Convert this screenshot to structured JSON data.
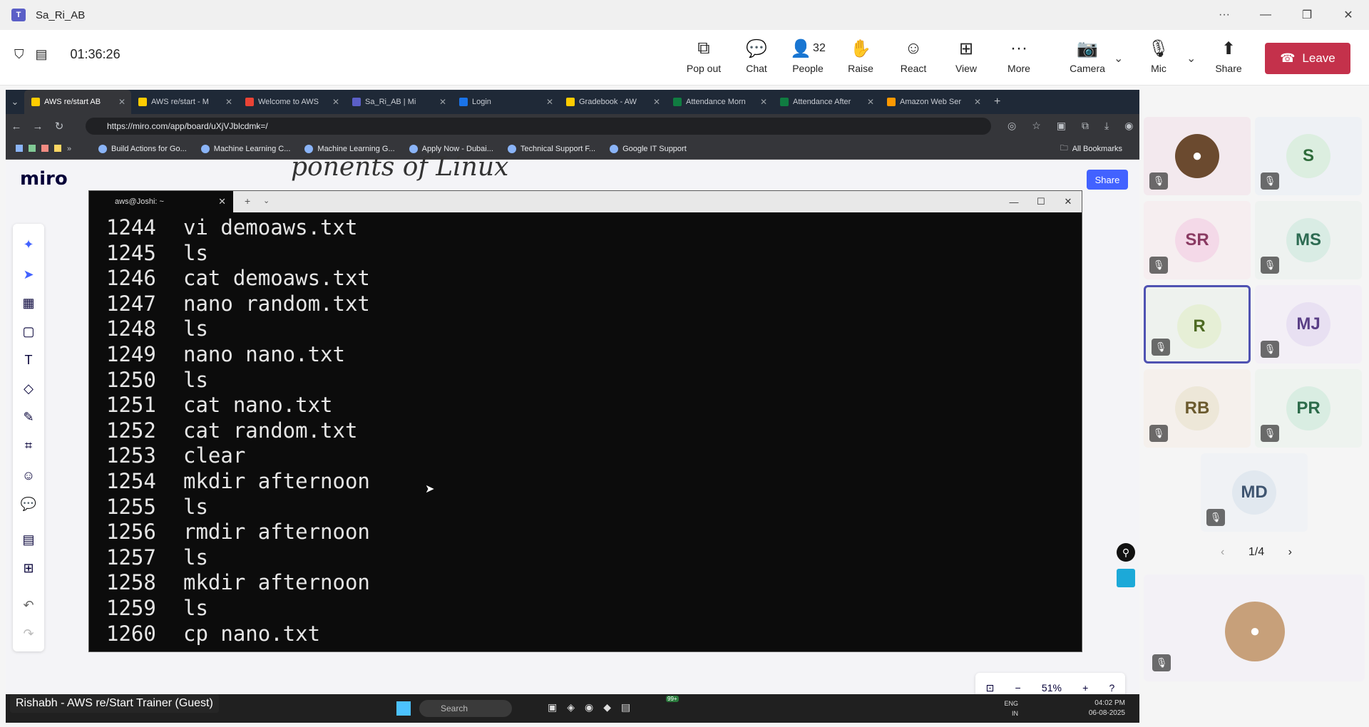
{
  "app": {
    "title": "Sa_Ri_AB",
    "logo": "T"
  },
  "meeting": {
    "timer": "01:36:26",
    "tools": [
      {
        "icon": "pop-out-icon",
        "glyph": "⧉",
        "label": "Pop out"
      },
      {
        "icon": "chat-icon",
        "glyph": "💬",
        "label": "Chat"
      },
      {
        "icon": "people-icon",
        "glyph": "👤",
        "label": "People",
        "count": "32"
      },
      {
        "icon": "raise-hand-icon",
        "glyph": "✋",
        "label": "Raise"
      },
      {
        "icon": "react-icon",
        "glyph": "☺",
        "label": "React"
      },
      {
        "icon": "view-icon",
        "glyph": "⊞",
        "label": "View"
      },
      {
        "icon": "more-icon",
        "glyph": "···",
        "label": "More"
      },
      {
        "icon": "camera-off-icon",
        "glyph": "📷",
        "label": "Camera"
      },
      {
        "icon": "mic-off-icon",
        "glyph": "🎙",
        "label": "Mic"
      },
      {
        "icon": "share-icon",
        "glyph": "⬆",
        "label": "Share"
      }
    ],
    "leave_label": "Leave"
  },
  "browser": {
    "tabs": [
      {
        "label": "AWS re/start AB",
        "color": "#ffcc00"
      },
      {
        "label": "AWS re/start - M",
        "color": "#ffcc00"
      },
      {
        "label": "Welcome to AWS",
        "color": "#ea4335"
      },
      {
        "label": "Sa_Ri_AB | Mi",
        "color": "#5b5fc7"
      },
      {
        "label": "Login",
        "color": "#1a73e8"
      },
      {
        "label": "Gradebook - AW",
        "color": "#ffcc00"
      },
      {
        "label": "Attendance Morn",
        "color": "#107c41"
      },
      {
        "label": "Attendance After",
        "color": "#107c41"
      },
      {
        "label": "Amazon Web Ser",
        "color": "#ff9900"
      }
    ],
    "url": "https://miro.com/app/board/uXjVJblcdmk=/",
    "bookmarks": [
      "Build Actions for Go...",
      "Machine Learning C...",
      "Machine Learning G...",
      "Apply Now - Dubai...",
      "Technical Support F...",
      "Google IT Support"
    ],
    "all_bookmarks": "All Bookmarks"
  },
  "miro": {
    "logo": "miro",
    "handwriting": "ponents    of Linux",
    "share_label": "Share",
    "zoom": "51%"
  },
  "terminal": {
    "tab_title": "aws@Joshi: ~",
    "lines": [
      {
        "num": "1244",
        "cmd": "vi demoaws.txt"
      },
      {
        "num": "1245",
        "cmd": "ls"
      },
      {
        "num": "1246",
        "cmd": "cat demoaws.txt"
      },
      {
        "num": "1247",
        "cmd": "nano random.txt"
      },
      {
        "num": "1248",
        "cmd": "ls"
      },
      {
        "num": "1249",
        "cmd": "nano nano.txt"
      },
      {
        "num": "1250",
        "cmd": "ls"
      },
      {
        "num": "1251",
        "cmd": "cat nano.txt"
      },
      {
        "num": "1252",
        "cmd": "cat random.txt"
      },
      {
        "num": "1253",
        "cmd": "clear"
      },
      {
        "num": "1254",
        "cmd": "mkdir afternoon"
      },
      {
        "num": "1255",
        "cmd": "ls"
      },
      {
        "num": "1256",
        "cmd": "rmdir afternoon"
      },
      {
        "num": "1257",
        "cmd": "ls"
      },
      {
        "num": "1258",
        "cmd": "mkdir afternoon"
      },
      {
        "num": "1259",
        "cmd": "ls"
      },
      {
        "num": "1260",
        "cmd": "cp nano.txt"
      }
    ]
  },
  "taskbar": {
    "search_placeholder": "Search",
    "lang": "ENG",
    "region": "IN",
    "time": "04:02 PM",
    "date": "06-08-2025",
    "badge": "99+"
  },
  "caption": "Rishabh - AWS re/Start Trainer (Guest)",
  "participants": [
    {
      "initials": "",
      "photo": true,
      "bg": "#f3e9ee",
      "avbg": "#6b4a2f",
      "color": "#fff"
    },
    {
      "initials": "S",
      "bg": "#eef1f5",
      "avbg": "#dceee0",
      "color": "#2e6b3a"
    },
    {
      "initials": "SR",
      "bg": "#f6eef0",
      "avbg": "#f4d9e8",
      "color": "#8a3a62"
    },
    {
      "initials": "MS",
      "bg": "#eef2f0",
      "avbg": "#d9ece4",
      "color": "#2d6b52"
    },
    {
      "initials": "R",
      "bg": "#eef2ee",
      "avbg": "#e6efd6",
      "color": "#4d6a22"
    },
    {
      "initials": "MJ",
      "bg": "#f3eff6",
      "avbg": "#e8e0f2",
      "color": "#5a3f86"
    },
    {
      "initials": "RB",
      "bg": "#f5f0ec",
      "avbg": "#ede7d8",
      "color": "#6b5a2e"
    },
    {
      "initials": "PR",
      "bg": "#eef3ef",
      "avbg": "#d9ede2",
      "color": "#2d6b4a"
    },
    {
      "initials": "MD",
      "bg": "#f0f2f5",
      "avbg": "#e1e8ef",
      "color": "#3f5570"
    },
    {
      "initials": "",
      "photo": true,
      "bg": "#f3f1f6",
      "avbg": "#c7a07a",
      "color": "#fff"
    }
  ],
  "pager": "1/4"
}
